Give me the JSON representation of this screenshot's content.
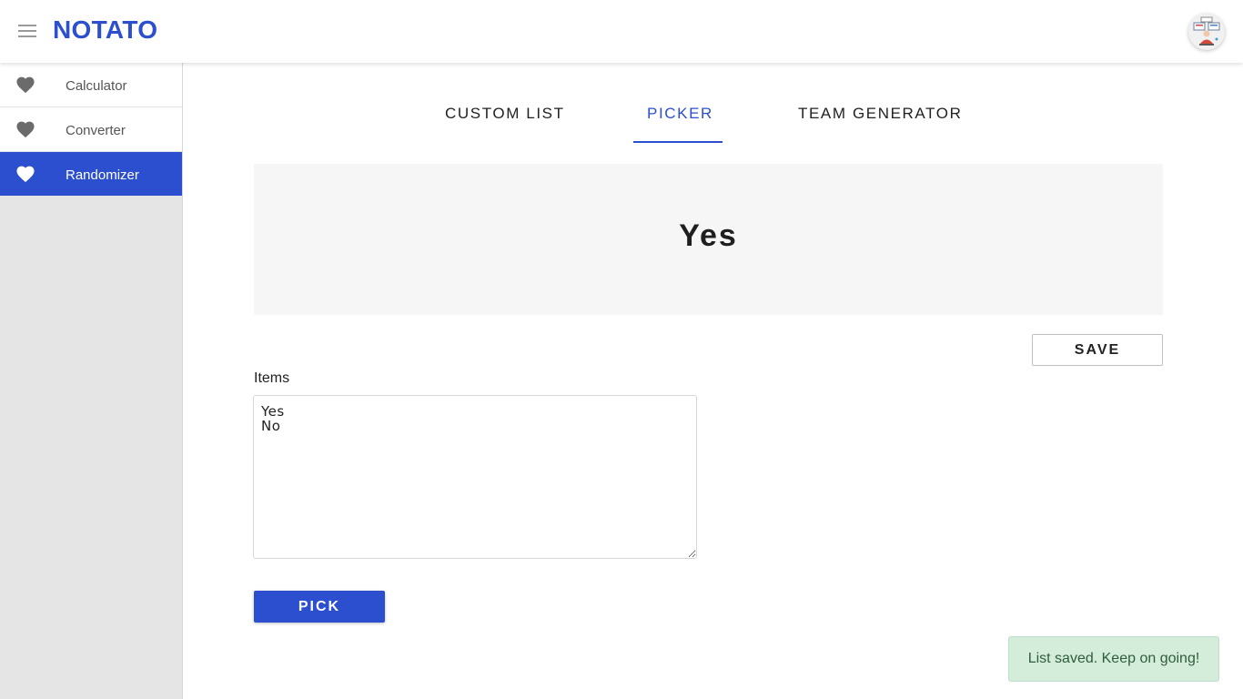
{
  "app": {
    "brand": "NOTATO",
    "menu_icon": "hamburger-menu-icon",
    "avatar_icon": "user-avatar"
  },
  "colors": {
    "accent": "#2b4fcf",
    "sidebar_bg": "#e5e5e5",
    "toast_bg": "#d4ecda",
    "toast_text": "#2f5e3c"
  },
  "sidebar": {
    "items": [
      {
        "label": "Calculator",
        "icon": "heart-icon",
        "active": false
      },
      {
        "label": "Converter",
        "icon": "heart-icon",
        "active": false
      },
      {
        "label": "Randomizer",
        "icon": "heart-icon",
        "active": true
      }
    ]
  },
  "tabs": [
    {
      "label": "CUSTOM LIST",
      "active": false
    },
    {
      "label": "PICKER",
      "active": true
    },
    {
      "label": "TEAM GENERATOR",
      "active": false
    }
  ],
  "picker": {
    "result": "Yes",
    "save_label": "SAVE",
    "items_label": "Items",
    "items_value": "Yes\nNo",
    "pick_label": "PICK"
  },
  "toast": {
    "message": "List saved. Keep on going!"
  }
}
